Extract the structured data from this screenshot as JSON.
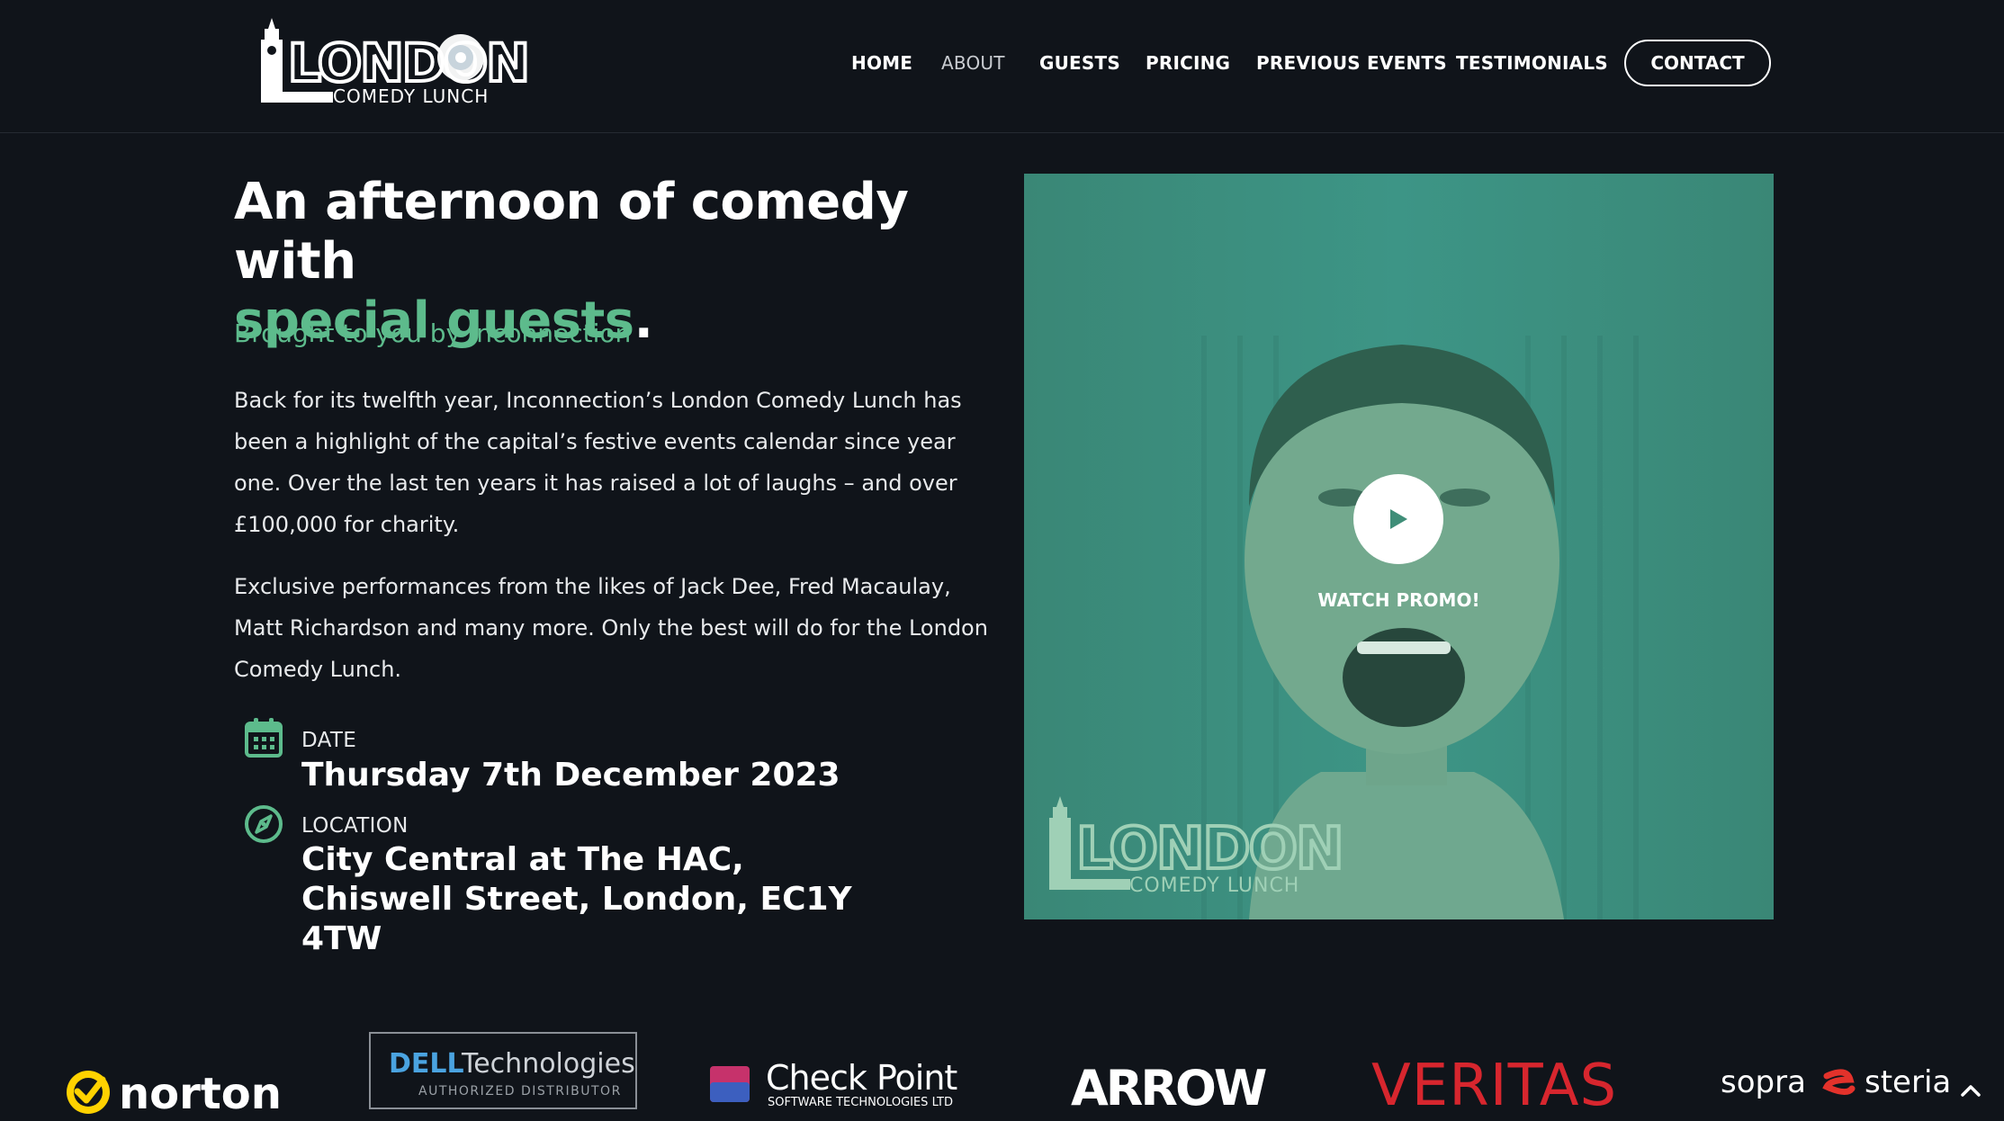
{
  "brand": {
    "logo_main": "LONDON",
    "logo_sub": "COMEDY LUNCH"
  },
  "nav": {
    "items": [
      {
        "label": "HOME"
      },
      {
        "label": "ABOUT"
      },
      {
        "label": "GUESTS"
      },
      {
        "label": "PRICING"
      },
      {
        "label": "PREVIOUS EVENTS"
      },
      {
        "label": "TESTIMONIALS"
      }
    ],
    "contact_label": "CONTACT"
  },
  "hero": {
    "title_line1": "An afternoon of comedy with",
    "title_accent": "special guests",
    "title_period": ".",
    "subtitle": "Brought to you by Inconnection",
    "paragraph1": "Back for its twelfth year, Inconnection’s London Comedy Lunch has been a highlight of the capital’s festive events calendar since year one. Over the last ten years it has raised a lot of laughs – and over £100,000 for charity.",
    "paragraph2": "Exclusive performances from the likes of Jack Dee, Fred Macaulay, Matt Richardson and many more. Only the best will do for the London Comedy Lunch."
  },
  "event": {
    "date_label": "DATE",
    "date_value": "Thursday 7th December 2023",
    "location_label": "LOCATION",
    "location_value": "City Central at The HAC, Chiswell Street, London, EC1Y 4TW"
  },
  "video": {
    "watch_label": "WATCH PROMO!"
  },
  "sponsors": {
    "norton": "norton",
    "dell_main": "Technologies",
    "dell_brand": "DELL",
    "dell_sub": "AUTHORIZED DISTRIBUTOR",
    "checkpoint_main": "Check Point",
    "checkpoint_sub": "SOFTWARE TECHNOLOGIES LTD",
    "arrow": "ARROW",
    "veritas": "VERITAS",
    "sopra": "sopra",
    "steria": "steria"
  },
  "colors": {
    "background": "#10141a",
    "accent": "#5dbb8c",
    "video_overlay": "#3f8e78"
  },
  "icons": [
    "calendar-icon",
    "compass-icon",
    "play-icon",
    "chevron-up-icon"
  ]
}
